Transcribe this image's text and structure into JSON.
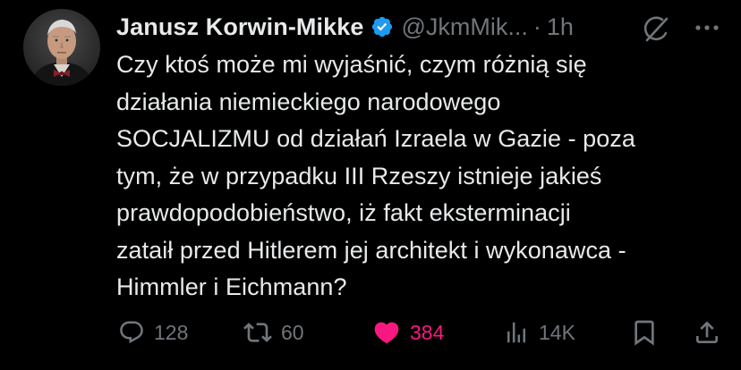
{
  "author": {
    "display_name": "Janusz Korwin-Mikke",
    "handle": "@JkmMik...",
    "separator": "·",
    "time": "1h",
    "verified": true
  },
  "tweet": {
    "text": "Czy ktoś może mi wyjaśnić, czym różnią się\ndziałania niemieckiego narodowego\nSOCJALIZMU od działań Izraela w Gazie - poza\ntym, że w przypadku III Rzeszy istnieje jakieś\nprawdopodobieństwo, iż fakt eksterminacji\nzataił przed Hitlerem jej architekt i wykonawca -\nHimmler i Eichmann?"
  },
  "actions": {
    "replies": "128",
    "reposts": "60",
    "likes": "384",
    "views": "14K"
  },
  "icons": {
    "reply": "reply-icon",
    "repost": "repost-icon",
    "like": "heart-icon",
    "views": "views-icon",
    "bookmark": "bookmark-icon",
    "share": "share-icon",
    "grok": "grok-icon",
    "more": "more-icon",
    "verified": "verified-badge-icon"
  },
  "colors": {
    "background": "#000000",
    "text": "#e7e9ea",
    "muted": "#71767b",
    "like": "#f91880",
    "verified": "#1d9bf0"
  }
}
